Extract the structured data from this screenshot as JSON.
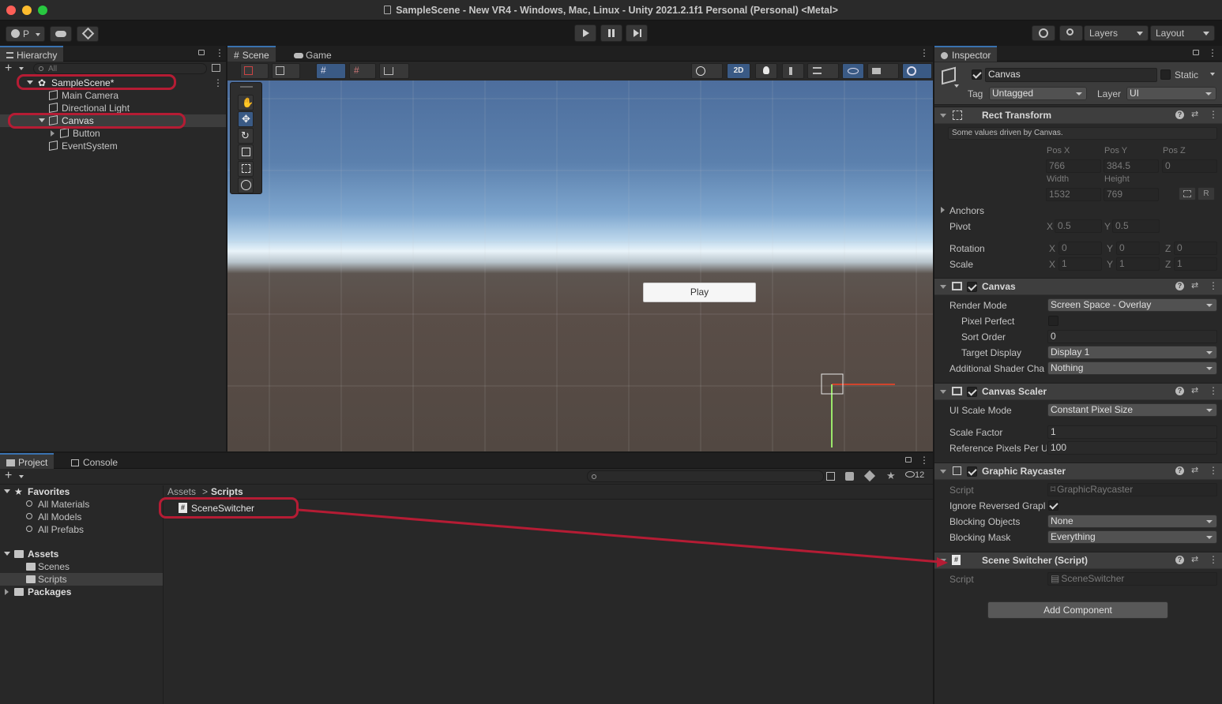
{
  "window": {
    "title": "SampleScene - New VR4 - Windows, Mac, Linux - Unity 2021.2.1f1 Personal (Personal) <Metal>"
  },
  "toolbar": {
    "account": "P",
    "layers": "Layers",
    "layout": "Layout"
  },
  "hierarchy": {
    "tab": "Hierarchy",
    "search_placeholder": "All",
    "items": [
      {
        "label": "SampleScene*"
      },
      {
        "label": "Main Camera"
      },
      {
        "label": "Directional Light"
      },
      {
        "label": "Canvas"
      },
      {
        "label": "Button"
      },
      {
        "label": "EventSystem"
      }
    ]
  },
  "scene": {
    "tabs": [
      {
        "label": "Scene"
      },
      {
        "label": "Game"
      }
    ],
    "mode_2d": "2D",
    "play_button": "Play"
  },
  "project": {
    "tabs": [
      {
        "label": "Project"
      },
      {
        "label": "Console"
      }
    ],
    "favorites": {
      "label": "Favorites",
      "items": [
        {
          "label": "All Materials"
        },
        {
          "label": "All Models"
        },
        {
          "label": "All Prefabs"
        }
      ]
    },
    "assets": {
      "label": "Assets",
      "items": [
        {
          "label": "Scenes"
        },
        {
          "label": "Scripts"
        }
      ]
    },
    "packages": "Packages",
    "breadcrumb": {
      "root": "Assets",
      "current": "Scripts"
    },
    "files": [
      {
        "label": "SceneSwitcher"
      }
    ],
    "hidden_count": "12"
  },
  "inspector": {
    "tab": "Inspector",
    "object_name": "Canvas",
    "static_label": "Static",
    "tag_label": "Tag",
    "tag_value": "Untagged",
    "layer_label": "Layer",
    "layer_value": "UI",
    "rect": {
      "title": "Rect Transform",
      "note": "Some values driven by Canvas.",
      "posx_label": "Pos X",
      "posy_label": "Pos Y",
      "posz_label": "Pos Z",
      "posx": "766",
      "posy": "384.5",
      "posz": "0",
      "width_label": "Width",
      "height_label": "Height",
      "width": "1532",
      "height": "769",
      "r_button": "R",
      "anchors": "Anchors",
      "pivot": "Pivot",
      "pivot_x": "0.5",
      "pivot_y": "0.5",
      "rotation": "Rotation",
      "rot_x": "0",
      "rot_y": "0",
      "rot_z": "0",
      "scale": "Scale",
      "scale_x": "1",
      "scale_y": "1",
      "scale_z": "1"
    },
    "canvas": {
      "title": "Canvas",
      "render_mode_label": "Render Mode",
      "render_mode": "Screen Space - Overlay",
      "pixel_perfect_label": "Pixel Perfect",
      "sort_order_label": "Sort Order",
      "sort_order": "0",
      "target_display_label": "Target Display",
      "target_display": "Display 1",
      "shader_label": "Additional Shader Cha",
      "shader": "Nothing"
    },
    "scaler": {
      "title": "Canvas Scaler",
      "mode_label": "UI Scale Mode",
      "mode": "Constant Pixel Size",
      "factor_label": "Scale Factor",
      "factor": "1",
      "ref_label": "Reference Pixels Per U",
      "ref": "100"
    },
    "raycaster": {
      "title": "Graphic Raycaster",
      "script_label": "Script",
      "script": "GraphicRaycaster",
      "ignore_label": "Ignore Reversed Grapl",
      "blocking_label": "Blocking Objects",
      "blocking": "None",
      "mask_label": "Blocking Mask",
      "mask": "Everything"
    },
    "switcher": {
      "title": "Scene Switcher (Script)",
      "script_label": "Script",
      "script": "SceneSwitcher"
    },
    "add_component": "Add Component"
  },
  "axis": {
    "x": "X",
    "y": "Y",
    "z": "Z"
  },
  "colors": {
    "highlight": "#b51c34",
    "accent": "#3a72b0",
    "sky_top": "#4a6a99",
    "ground": "#5a4e48"
  },
  "icons": [
    "lock-icon",
    "kebab-icon",
    "plus-icon",
    "search-icon",
    "hand-tool-icon",
    "move-tool-icon",
    "rotate-tool-icon",
    "scale-tool-icon",
    "rect-tool-icon",
    "transform-tool-icon",
    "play-icon",
    "pause-icon",
    "step-icon",
    "cloud-icon",
    "history-icon",
    "help-icon",
    "settings-icon",
    "folder-icon",
    "star-icon",
    "script-icon",
    "gameobject-icon",
    "unity-scene-icon"
  ]
}
